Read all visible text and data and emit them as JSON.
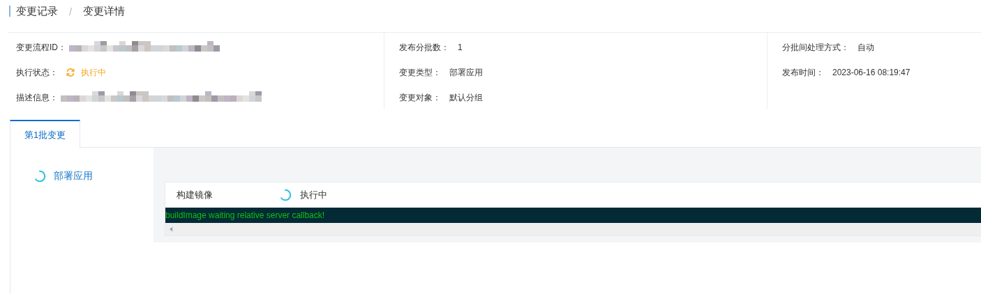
{
  "breadcrumb": [
    {
      "label": "变更记录"
    },
    {
      "label": "变更详情"
    }
  ],
  "breadcrumb_separator": "/",
  "info_columns": [
    [
      {
        "label": "变更流程ID：",
        "kind": "redacted"
      },
      {
        "label": "执行状态：",
        "kind": "status",
        "running": true,
        "value": "执行中"
      },
      {
        "label": "描述信息：",
        "kind": "redacted"
      }
    ],
    [
      {
        "label": "发布分批数：",
        "kind": "text",
        "value": "1"
      },
      {
        "label": "变更类型：",
        "kind": "text",
        "value": "部署应用"
      },
      {
        "label": "变更对象：",
        "kind": "text",
        "value": "默认分组"
      }
    ],
    [
      {
        "label": "分批间处理方式：",
        "kind": "text",
        "value": "自动"
      },
      {
        "label": "发布时间：",
        "kind": "text",
        "value": "2023-06-16 08:19:47"
      }
    ]
  ],
  "tabs": [
    {
      "label": "第1批变更",
      "selected": true
    }
  ],
  "stages": [
    {
      "label": "部署应用",
      "running": true,
      "selected": true
    }
  ],
  "tasks": [
    {
      "name": "构建镜像",
      "running": true,
      "status_text": "执行中",
      "log": "buildImage waiting relative server callback!"
    }
  ]
}
